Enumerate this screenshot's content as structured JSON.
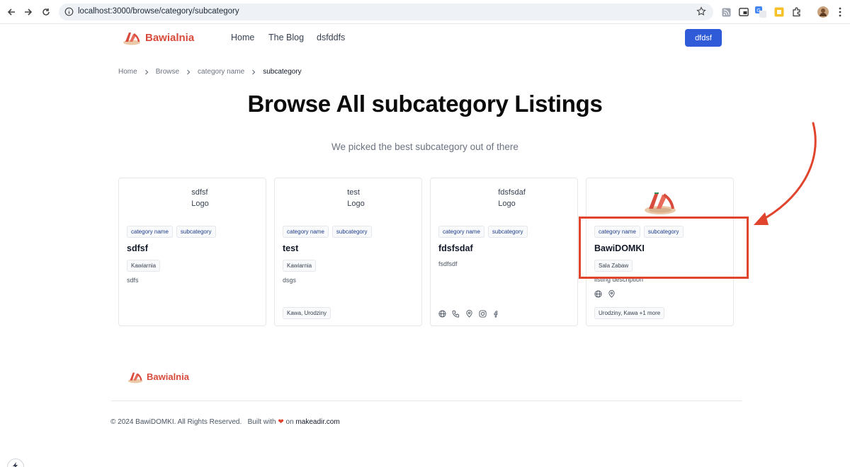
{
  "browser": {
    "url": "localhost:3000/browse/category/subcategory"
  },
  "header": {
    "brand": "Bawialnia",
    "nav": [
      "Home",
      "The Blog",
      "dsfddfs"
    ],
    "button": "dfdsf"
  },
  "breadcrumb": [
    "Home",
    "Browse",
    "category name",
    "subcategory"
  ],
  "page": {
    "title": "Browse All subcategory Listings",
    "subtitle": "We picked the best subcategory out of there"
  },
  "cards": [
    {
      "image_alt": [
        "sdfsf",
        "Logo"
      ],
      "tags": [
        "category name",
        "subcategory"
      ],
      "title": "sdfsf",
      "badge": "Kawiarnia",
      "description": "sdfs",
      "footer_tag": ""
    },
    {
      "image_alt": [
        "test",
        "Logo"
      ],
      "tags": [
        "category name",
        "subcategory"
      ],
      "title": "test",
      "badge": "Kawiarnia",
      "description": "dsgs",
      "footer_tag": "Kawa, Urodziny"
    },
    {
      "image_alt": [
        "fdsfsdaf",
        "Logo"
      ],
      "tags": [
        "category name",
        "subcategory"
      ],
      "title": "fdsfsdaf",
      "badge": "",
      "description": "fsdfsdf",
      "footer_tag": "",
      "icons": [
        "globe-icon",
        "phone-icon",
        "map-pin-icon",
        "instagram-icon",
        "facebook-icon"
      ]
    },
    {
      "image_alt": [],
      "tags": [
        "category name",
        "subcategory"
      ],
      "title": "BawiDOMKI",
      "badge": "Sala Zabaw",
      "description": "listing description",
      "footer_tag": "Urodziny, Kawa +1 more",
      "icons": [
        "globe-icon",
        "map-pin-icon"
      ]
    }
  ],
  "footer": {
    "brand": "Bawialnia",
    "copyright": "© 2024 BawiDOMKI. All Rights Reserved.",
    "built_with": "Built with",
    "on": "on",
    "site": "makeadir.com"
  },
  "colors": {
    "brand": "#d84a3b",
    "primary_button": "#2f5bd8",
    "annotation": "#e0442c"
  }
}
